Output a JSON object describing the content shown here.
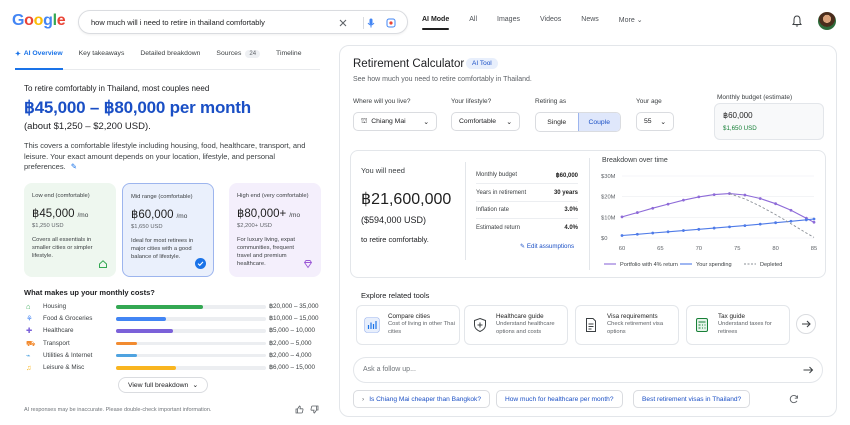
{
  "search": {
    "query": "how much will i need to retire in thailand comfortably",
    "logo_letters": [
      "G",
      "o",
      "o",
      "g",
      "l",
      "e"
    ],
    "logo_colors": [
      "#4285f4",
      "#ea4335",
      "#fbbc05",
      "#4285f4",
      "#34a853",
      "#ea4335"
    ]
  },
  "nav": {
    "tabs": [
      "AI Mode",
      "All",
      "Images",
      "Videos",
      "News"
    ],
    "more": "More"
  },
  "left": {
    "subtabs": {
      "overview": "AI Overview",
      "takeaways": "Key takeaways",
      "breakdown": "Detailed breakdown",
      "sources": "Sources",
      "sources_count": "24",
      "timeline": "Timeline"
    },
    "intro": "To retire comfortably in Thailand, most couples need",
    "big_price": "฿45,000 – ฿80,000 per month",
    "usd_range": "(about $1,250 – $2,200 USD).",
    "description": "This covers a comfortable lifestyle including housing, food, healthcare, transport, and leisure. Your exact amount depends on your location, lifestyle, and personal preferences.",
    "cards": [
      {
        "title": "Low end (comfortable)",
        "price": "฿45,000",
        "unit": "/mo",
        "usd": "$1,250 USD",
        "desc": "Covers all essentials in smaller cities or simpler lifestyle."
      },
      {
        "title": "Mid range (comfortable)",
        "price": "฿60,000",
        "unit": "/mo",
        "usd": "$1,650 USD",
        "desc": "Ideal for most retirees in major cities with a good balance of lifestyle."
      },
      {
        "title": "High end (very comfortable)",
        "price": "฿80,000+",
        "unit": "/mo",
        "usd": "$2,200+ USD",
        "desc": "For luxury living, expat communities, frequent travel and premium healthcare."
      }
    ],
    "costs_title": "What makes up your monthly costs?",
    "costs": [
      {
        "label": "Housing",
        "range": "฿20,000 – 35,000",
        "fill": 0.58,
        "color": "#34a853"
      },
      {
        "label": "Food & Groceries",
        "range": "฿10,000 – 15,000",
        "fill": 0.33,
        "color": "#4285f4"
      },
      {
        "label": "Healthcare",
        "range": "฿5,000 – 10,000",
        "fill": 0.38,
        "color": "#7b61d9"
      },
      {
        "label": "Transport",
        "range": "฿2,000 – 5,000",
        "fill": 0.14,
        "color": "#f28b30"
      },
      {
        "label": "Utilities & Internet",
        "range": "฿2,000 – 4,000",
        "fill": 0.14,
        "color": "#4fa3e0"
      },
      {
        "label": "Leisure & Misc",
        "range": "฿6,000 – 15,000",
        "fill": 0.4,
        "color": "#f9b51f"
      }
    ],
    "view_button": "View full breakdown",
    "disclaimer": "AI responses may be inaccurate. Please double-check important information."
  },
  "calc": {
    "title": "Retirement Calculator",
    "badge": "AI Tool",
    "subtitle": "See how much you need to retire comfortably in Thailand.",
    "fields": {
      "where_label": "Where will you live?",
      "where_value": "Chiang Mai",
      "lifestyle_label": "Your lifestyle?",
      "lifestyle_value": "Comfortable",
      "retiring_label": "Retiring as",
      "retiring_options": [
        "Single",
        "Couple"
      ],
      "retiring_selected": "Couple",
      "age_label": "Your age",
      "age_value": "55",
      "budget_label": "Monthly budget (estimate)",
      "budget_value": "฿60,000",
      "budget_usd": "$1,650 USD"
    },
    "result": {
      "label": "You will need",
      "amount": "฿21,600,000",
      "usd": "($594,000 USD)",
      "sub": "to retire comfortably."
    },
    "stats": [
      {
        "label": "Monthly budget",
        "value": "฿60,000"
      },
      {
        "label": "Years in retirement",
        "value": "30 years"
      },
      {
        "label": "Inflation rate",
        "value": "3.0%"
      },
      {
        "label": "Estimated return",
        "value": "4.0%"
      }
    ],
    "edit_link": "Edit assumptions",
    "explore_title": "Explore related tools",
    "tools": [
      {
        "title": "Compare cities",
        "desc": "Cost of living in other Thai cities"
      },
      {
        "title": "Healthcare guide",
        "desc": "Understand healthcare options and costs"
      },
      {
        "title": "Visa requirements",
        "desc": "Check retirement visa options"
      },
      {
        "title": "Tax guide",
        "desc": "Understand taxes for retirees"
      }
    ],
    "ask_placeholder": "Ask a follow up...",
    "suggestions": [
      "Is Chiang Mai cheaper than Bangkok?",
      "How much for healthcare per month?",
      "Best retirement visas in Thailand?"
    ]
  },
  "chart_data": {
    "type": "line",
    "title": "Breakdown over time",
    "x": [
      60,
      62,
      64,
      66,
      68,
      70,
      72,
      74,
      76,
      78,
      80,
      82,
      84,
      85
    ],
    "xticks": [
      60,
      65,
      70,
      75,
      80,
      85
    ],
    "yticks": [
      "$0",
      "$10M",
      "$20M",
      "$30M"
    ],
    "ylim": [
      0,
      30
    ],
    "series": [
      {
        "name": "Portfolio with 4% return",
        "color": "#8e6bd8",
        "style": "solid-dots",
        "values": [
          10.2,
          12.3,
          14.4,
          16.4,
          18.3,
          19.9,
          21.0,
          21.5,
          20.8,
          19.1,
          16.6,
          13.4,
          9.6,
          7.6
        ]
      },
      {
        "name": "Your spending",
        "color": "#4f7be8",
        "style": "solid-dots",
        "values": [
          1.2,
          1.8,
          2.4,
          3.0,
          3.6,
          4.2,
          4.8,
          5.4,
          6.0,
          6.7,
          7.4,
          8.1,
          8.8,
          9.2
        ]
      },
      {
        "name": "Depleted",
        "color": "#8a8f96",
        "style": "dashed",
        "values": [
          null,
          null,
          null,
          null,
          null,
          null,
          null,
          21.5,
          18.9,
          15.4,
          11.3,
          6.9,
          2.4,
          0.3
        ]
      }
    ],
    "legend_position": "bottom"
  }
}
